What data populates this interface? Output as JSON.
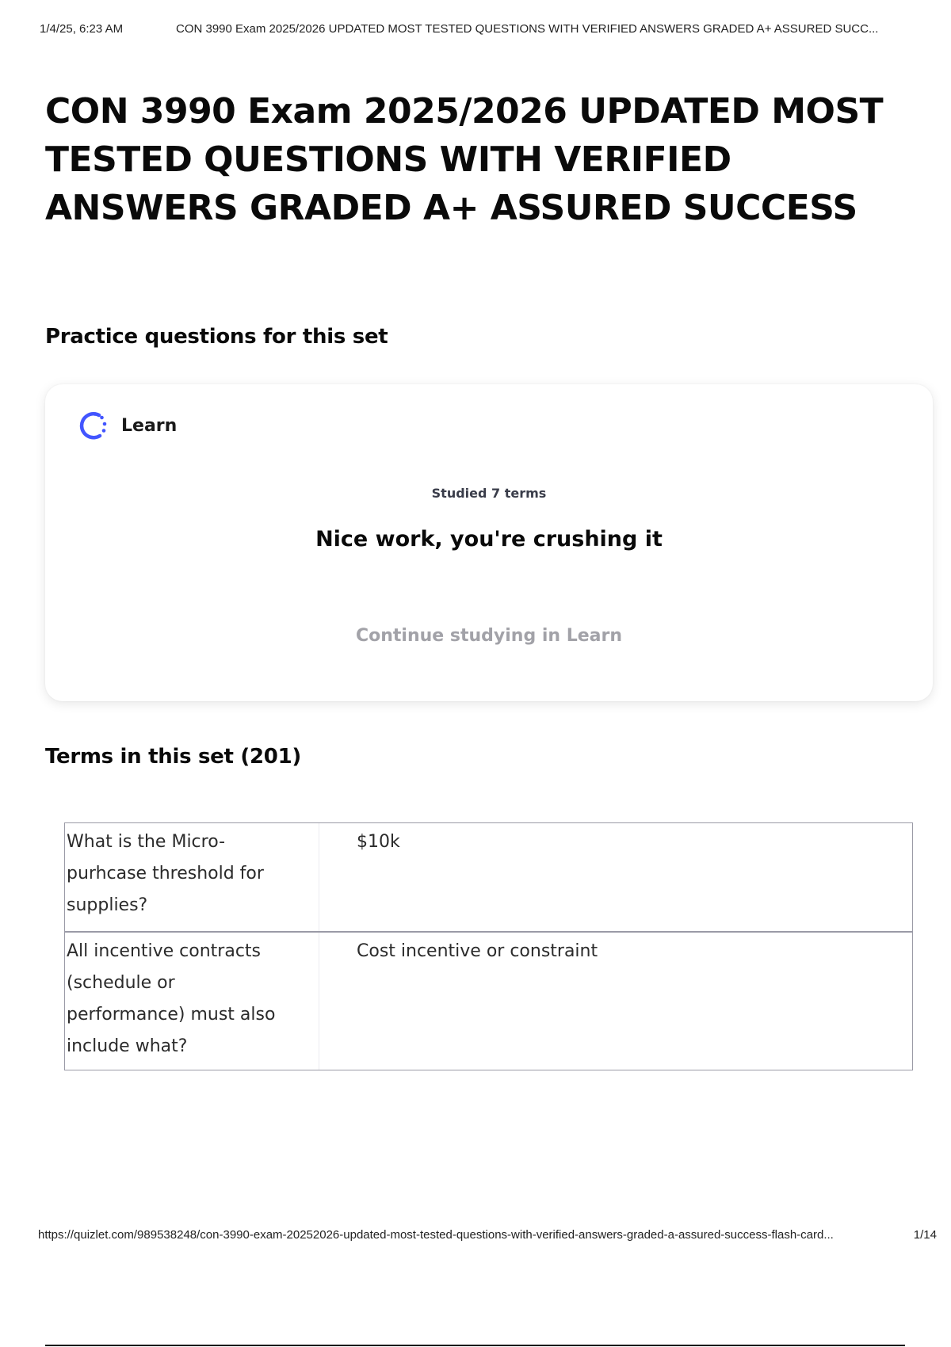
{
  "print_header": {
    "date": "1/4/25, 6:23 AM",
    "title": "CON 3990 Exam 2025/2026 UPDATED MOST TESTED QUESTIONS WITH VERIFIED ANSWERS GRADED A+ ASSURED SUCC..."
  },
  "page": {
    "title": "CON 3990 Exam 2025/2026 UPDATED MOST TESTED QUESTIONS WITH VERIFIED ANSWERS GRADED A+ ASSURED SUCCESS"
  },
  "practice": {
    "heading": "Practice questions for this set",
    "learn_label": "Learn",
    "learn_icon": "learn-progress-icon",
    "studied": "Studied 7 terms",
    "praise": "Nice work, you're crushing it",
    "continue_label": "Continue studying in Learn"
  },
  "terms": {
    "heading": "Terms in this set (201)",
    "rows": [
      {
        "term_lines": [
          "What is the Micro-",
          "purhcase threshold for",
          "supplies?"
        ],
        "definition": "$10k"
      },
      {
        "term_lines": [
          "All incentive contracts",
          "(schedule or",
          "performance) must also",
          "include what?"
        ],
        "definition": "Cost incentive or constraint"
      }
    ]
  },
  "print_footer": {
    "url": "https://quizlet.com/989538248/con-3990-exam-20252026-updated-most-tested-questions-with-verified-answers-graded-a-assured-success-flash-card...",
    "page_indicator": "1/14"
  },
  "colors": {
    "accent": "#4255ff",
    "muted_button": "#a2a2a8",
    "table_border": "#9a9aa6"
  }
}
